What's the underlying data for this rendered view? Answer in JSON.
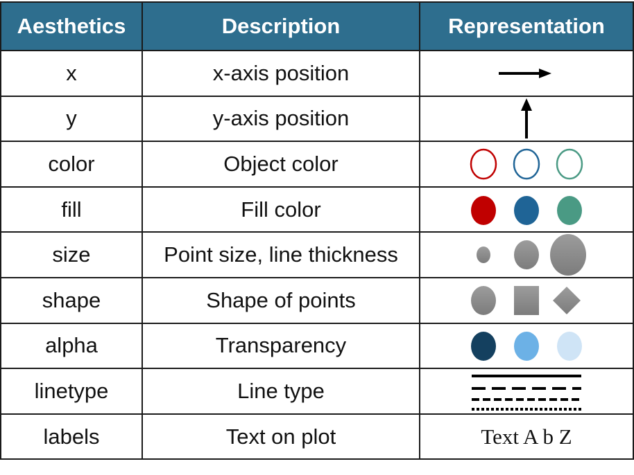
{
  "header": {
    "aesthetics": "Aesthetics",
    "description": "Description",
    "representation": "Representation"
  },
  "colors": {
    "header_bg": "#2e6e8e",
    "red": "#c00000",
    "blue": "#1f6496",
    "green": "#4a9a84",
    "dark_navy": "#14405f",
    "light_blue": "#6cb1e6",
    "pale_blue": "#cfe4f6",
    "gray": "#8a8a8a"
  },
  "rows": [
    {
      "aesthetic": "x",
      "description": "x-axis position",
      "icon": "right-arrow-icon"
    },
    {
      "aesthetic": "y",
      "description": "y-axis position",
      "icon": "up-arrow-icon"
    },
    {
      "aesthetic": "color",
      "description": "Object color",
      "icon": "outlined-circles-icon"
    },
    {
      "aesthetic": "fill",
      "description": "Fill color",
      "icon": "filled-circles-icon"
    },
    {
      "aesthetic": "size",
      "description": "Point size, line thickness",
      "icon": "sized-circles-icon"
    },
    {
      "aesthetic": "shape",
      "description": "Shape of points",
      "icon": "shapes-icon"
    },
    {
      "aesthetic": "alpha",
      "description": "Transparency",
      "icon": "transparency-circles-icon"
    },
    {
      "aesthetic": "linetype",
      "description": "Line type",
      "icon": "line-types-icon"
    },
    {
      "aesthetic": "labels",
      "description": "Text on plot",
      "representation_text": "Text A b Z"
    }
  ]
}
